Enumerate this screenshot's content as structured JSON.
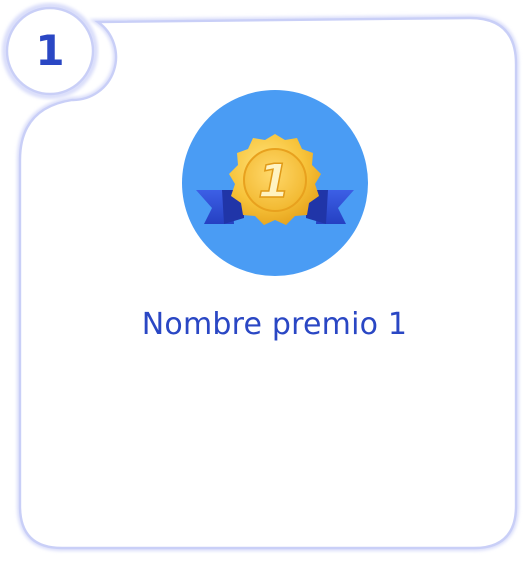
{
  "badge": {
    "rank": "1"
  },
  "award": {
    "medal_icon": "gold-medal-with-ribbon-icon",
    "medal_number": "1",
    "name": "Nombre premio 1"
  },
  "colors": {
    "accent": "#2a47c4",
    "frame_outline": "#c9cff7",
    "circle_background": "#4a9cf4",
    "medal_gold": "#f7c33a",
    "ribbon_blue": "#2f4fd6"
  }
}
